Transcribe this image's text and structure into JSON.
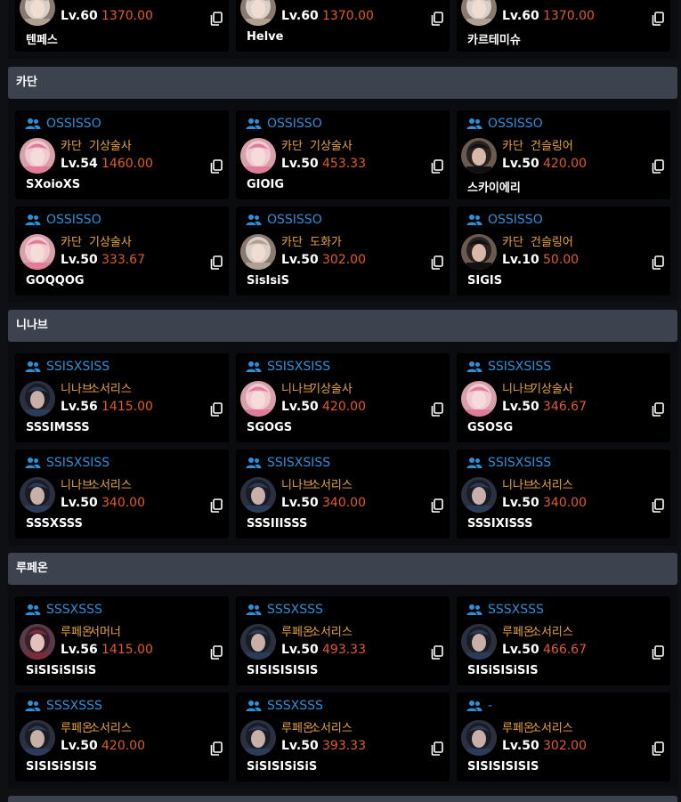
{
  "colors": {
    "guild": "#2b8fd9",
    "server_job": "#e8a33c",
    "item_level": "#e05a2a",
    "header_bg": "#3d424f"
  },
  "top_partial": [
    {
      "level": "Lv.60",
      "ilvl": "1370.00",
      "name": "텐페스"
    },
    {
      "level": "Lv.60",
      "ilvl": "1370.00",
      "name": "Helve"
    },
    {
      "level": "Lv.60",
      "ilvl": "1370.00",
      "name": "카르테미슈"
    }
  ],
  "groups": [
    {
      "title": "카단",
      "cards": [
        {
          "guild": "OSSISSO",
          "server": "카단",
          "job": "기상술사",
          "level": "Lv.54",
          "ilvl": "1460.00",
          "name": "SXoioXS",
          "avatar": "pink"
        },
        {
          "guild": "OSSISSO",
          "server": "카단",
          "job": "기상술사",
          "level": "Lv.50",
          "ilvl": "453.33",
          "name": "GIOIG",
          "avatar": "pink"
        },
        {
          "guild": "OSSISSO",
          "server": "카단",
          "job": "건슬링어",
          "level": "Lv.50",
          "ilvl": "420.00",
          "name": "스카이에리",
          "avatar": "gunslinger"
        },
        {
          "guild": "OSSISSO",
          "server": "카단",
          "job": "기상술사",
          "level": "Lv.50",
          "ilvl": "333.67",
          "name": "GOQQOG",
          "avatar": "pink"
        },
        {
          "guild": "OSSISSO",
          "server": "카단",
          "job": "도화가",
          "level": "Lv.50",
          "ilvl": "302.00",
          "name": "SisIsiS",
          "avatar": "artist"
        },
        {
          "guild": "OSSISSO",
          "server": "카단",
          "job": "건슬링어",
          "level": "Lv.10",
          "ilvl": "50.00",
          "name": "SIGIS",
          "avatar": "gunslinger"
        }
      ]
    },
    {
      "title": "니나브",
      "cards": [
        {
          "guild": "SSISXSISS",
          "server": "니나브",
          "job": "소서리스",
          "level": "Lv.56",
          "ilvl": "1415.00",
          "name": "SSSIMSSS",
          "avatar": "sorc"
        },
        {
          "guild": "SSISXSISS",
          "server": "니나브",
          "job": "기상술사",
          "level": "Lv.50",
          "ilvl": "420.00",
          "name": "SGOGS",
          "avatar": "pink"
        },
        {
          "guild": "SSISXSISS",
          "server": "니나브",
          "job": "기상술사",
          "level": "Lv.50",
          "ilvl": "346.67",
          "name": "GSOSG",
          "avatar": "pink"
        },
        {
          "guild": "SSISXSISS",
          "server": "니나브",
          "job": "소서리스",
          "level": "Lv.50",
          "ilvl": "340.00",
          "name": "SSSXSSS",
          "avatar": "sorc"
        },
        {
          "guild": "SSISXSISS",
          "server": "니나브",
          "job": "소서리스",
          "level": "Lv.50",
          "ilvl": "340.00",
          "name": "SSSIIISSS",
          "avatar": "sorc"
        },
        {
          "guild": "SSISXSISS",
          "server": "니나브",
          "job": "소서리스",
          "level": "Lv.50",
          "ilvl": "340.00",
          "name": "SSSIXISSS",
          "avatar": "sorc"
        }
      ]
    },
    {
      "title": "루페온",
      "cards": [
        {
          "guild": "SSSXSSS",
          "server": "루페온",
          "job": "서머너",
          "level": "Lv.56",
          "ilvl": "1415.00",
          "name": "SiSISiSISiS",
          "avatar": "summoner"
        },
        {
          "guild": "SSSXSSS",
          "server": "루페온",
          "job": "소서리스",
          "level": "Lv.50",
          "ilvl": "493.33",
          "name": "SISISISISIS",
          "avatar": "sorc"
        },
        {
          "guild": "SSSXSSS",
          "server": "루페온",
          "job": "소서리스",
          "level": "Lv.50",
          "ilvl": "466.67",
          "name": "SISiSISiSIS",
          "avatar": "sorc"
        },
        {
          "guild": "SSSXSSS",
          "server": "루페온",
          "job": "소서리스",
          "level": "Lv.50",
          "ilvl": "420.00",
          "name": "SISISiSISIS",
          "avatar": "sorc"
        },
        {
          "guild": "SSSXSSS",
          "server": "루페온",
          "job": "소서리스",
          "level": "Lv.50",
          "ilvl": "393.33",
          "name": "SiSISISiSiS",
          "avatar": "sorc"
        },
        {
          "guild": "-",
          "server": "루페온",
          "job": "소서리스",
          "level": "Lv.50",
          "ilvl": "302.00",
          "name": "SISISISISIS",
          "avatar": "sorc"
        }
      ]
    }
  ]
}
